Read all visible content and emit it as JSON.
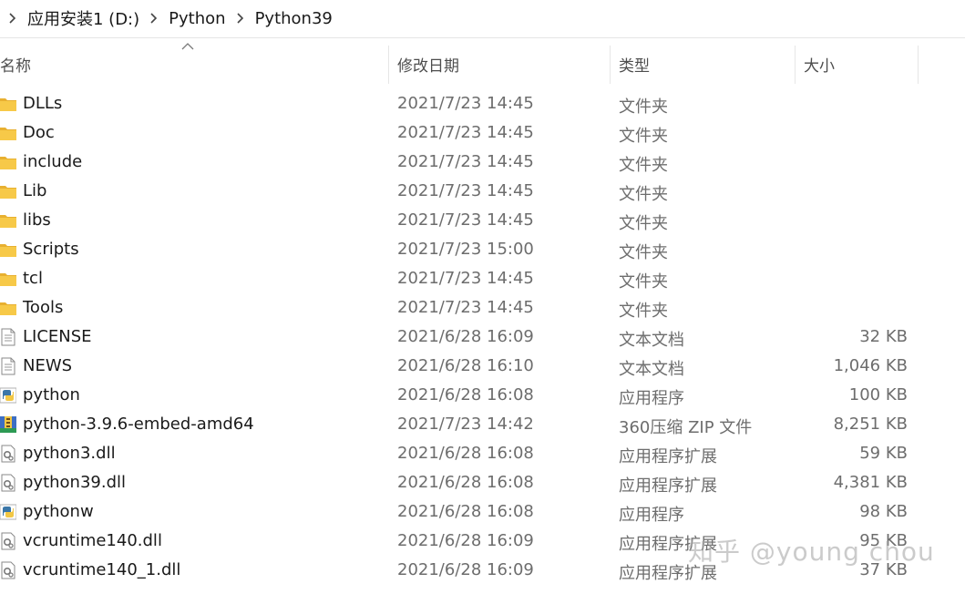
{
  "breadcrumb": {
    "items": [
      "应用安装1 (D:)",
      "Python",
      "Python39"
    ]
  },
  "columns": {
    "name": "名称",
    "date": "修改日期",
    "type": "类型",
    "size": "大小"
  },
  "files": [
    {
      "name": "DLLs",
      "date": "2021/7/23 14:45",
      "type": "文件夹",
      "size": "",
      "icon": "folder-icon"
    },
    {
      "name": "Doc",
      "date": "2021/7/23 14:45",
      "type": "文件夹",
      "size": "",
      "icon": "folder-icon"
    },
    {
      "name": "include",
      "date": "2021/7/23 14:45",
      "type": "文件夹",
      "size": "",
      "icon": "folder-icon"
    },
    {
      "name": "Lib",
      "date": "2021/7/23 14:45",
      "type": "文件夹",
      "size": "",
      "icon": "folder-icon"
    },
    {
      "name": "libs",
      "date": "2021/7/23 14:45",
      "type": "文件夹",
      "size": "",
      "icon": "folder-icon"
    },
    {
      "name": "Scripts",
      "date": "2021/7/23 15:00",
      "type": "文件夹",
      "size": "",
      "icon": "folder-icon"
    },
    {
      "name": "tcl",
      "date": "2021/7/23 14:45",
      "type": "文件夹",
      "size": "",
      "icon": "folder-icon"
    },
    {
      "name": "Tools",
      "date": "2021/7/23 14:45",
      "type": "文件夹",
      "size": "",
      "icon": "folder-icon"
    },
    {
      "name": "LICENSE",
      "date": "2021/6/28 16:09",
      "type": "文本文档",
      "size": "32 KB",
      "icon": "text-document-icon"
    },
    {
      "name": "NEWS",
      "date": "2021/6/28 16:10",
      "type": "文本文档",
      "size": "1,046 KB",
      "icon": "text-document-icon"
    },
    {
      "name": "python",
      "date": "2021/6/28 16:08",
      "type": "应用程序",
      "size": "100 KB",
      "icon": "python-app-icon"
    },
    {
      "name": "python-3.9.6-embed-amd64",
      "date": "2021/7/23 14:42",
      "type": "360压缩 ZIP 文件",
      "size": "8,251 KB",
      "icon": "zip-archive-icon"
    },
    {
      "name": "python3.dll",
      "date": "2021/6/28 16:08",
      "type": "应用程序扩展",
      "size": "59 KB",
      "icon": "dll-gear-icon"
    },
    {
      "name": "python39.dll",
      "date": "2021/6/28 16:08",
      "type": "应用程序扩展",
      "size": "4,381 KB",
      "icon": "dll-gear-icon"
    },
    {
      "name": "pythonw",
      "date": "2021/6/28 16:08",
      "type": "应用程序",
      "size": "98 KB",
      "icon": "python-app-icon"
    },
    {
      "name": "vcruntime140.dll",
      "date": "2021/6/28 16:09",
      "type": "应用程序扩展",
      "size": "95 KB",
      "icon": "dll-gear-icon"
    },
    {
      "name": "vcruntime140_1.dll",
      "date": "2021/6/28 16:09",
      "type": "应用程序扩展",
      "size": "37 KB",
      "icon": "dll-gear-icon"
    }
  ],
  "watermark": "知乎 @young chou",
  "colors": {
    "folder": "#f7c948",
    "secondary_text": "#6d6d6d"
  }
}
